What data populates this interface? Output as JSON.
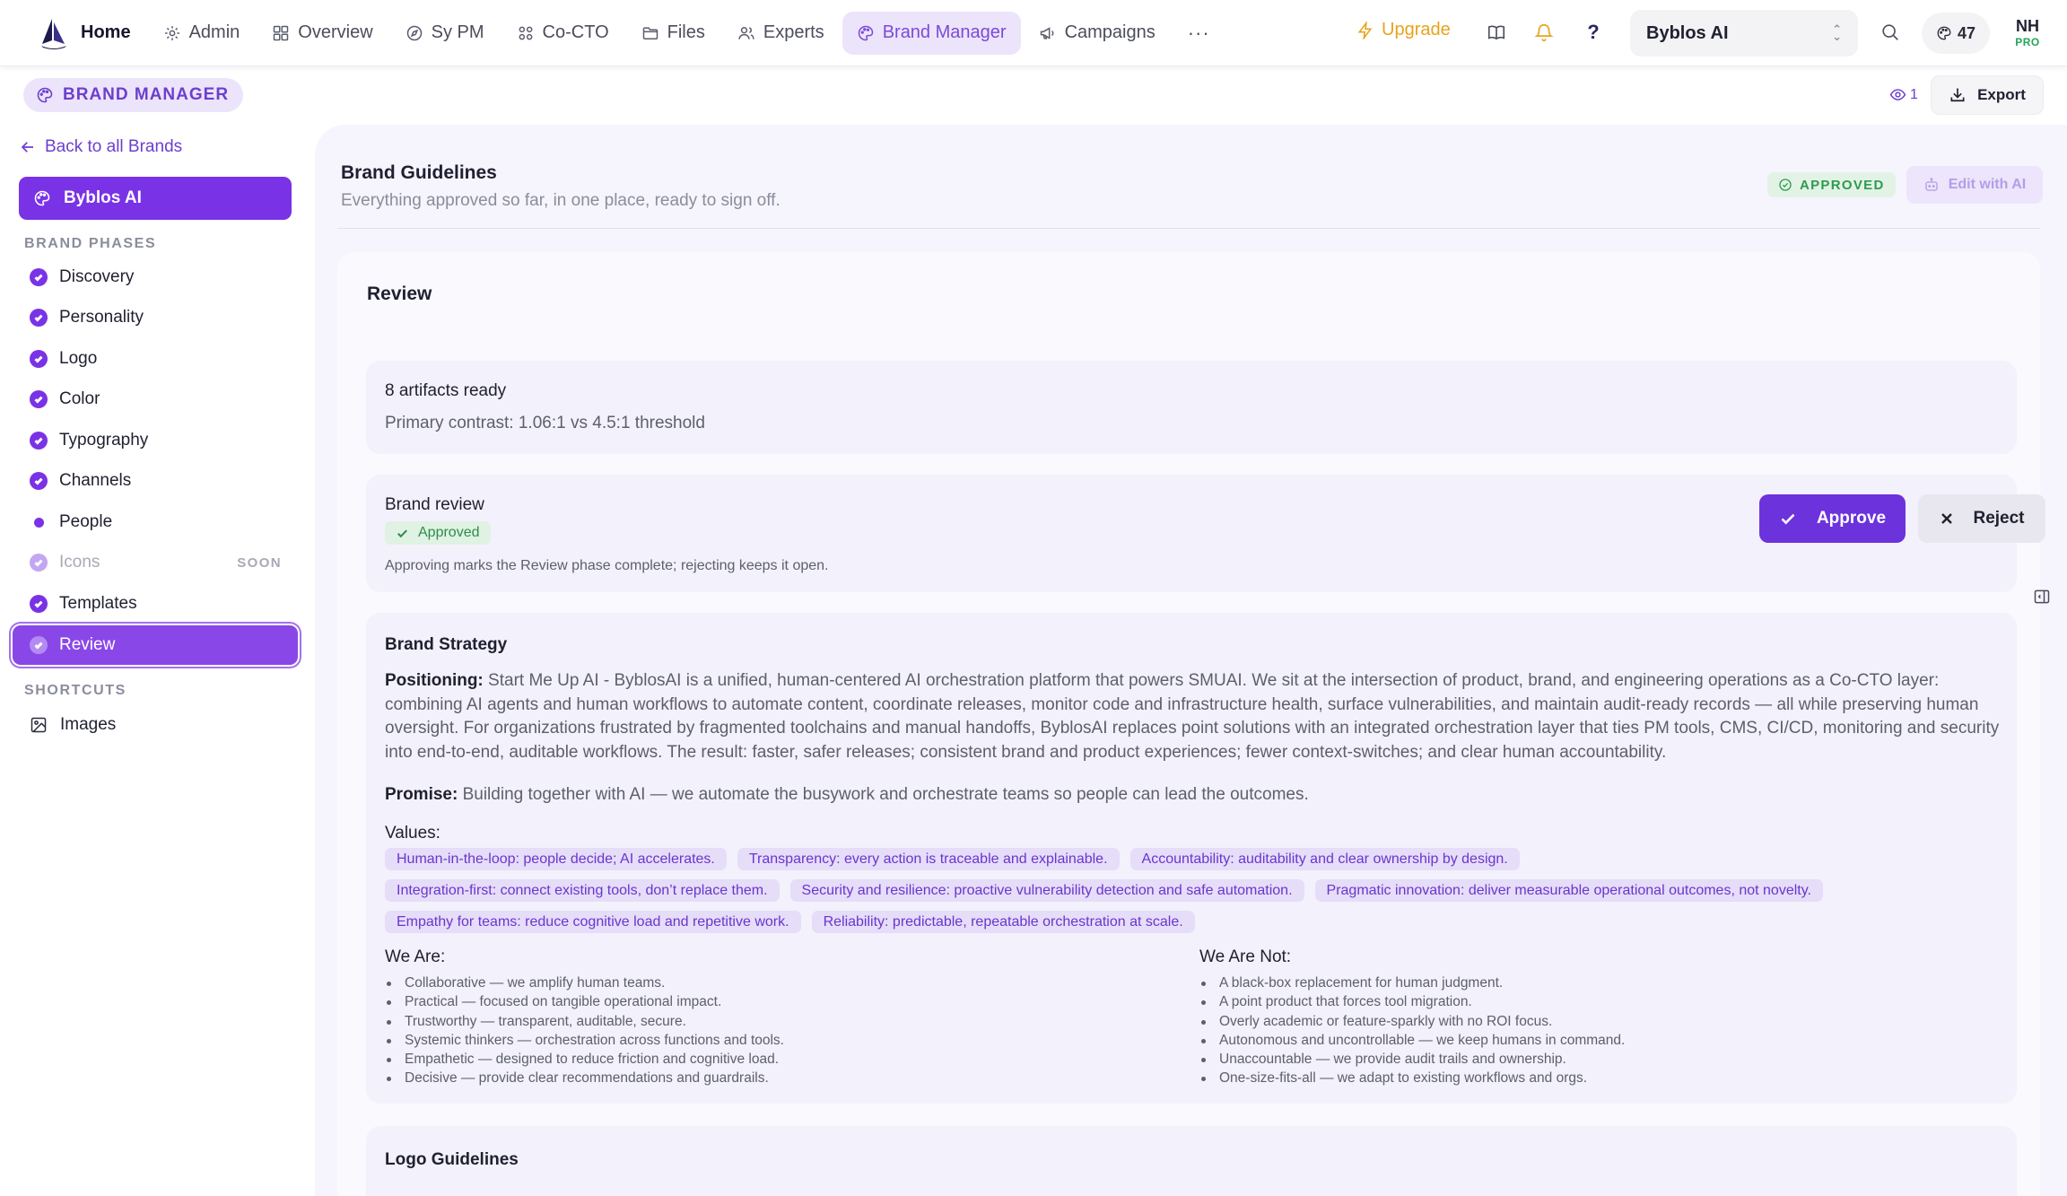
{
  "nav": {
    "home": "Home",
    "items": [
      {
        "label": "Admin",
        "icon": "gear-icon"
      },
      {
        "label": "Overview",
        "icon": "grid-icon"
      },
      {
        "label": "Sy PM",
        "icon": "compass-icon"
      },
      {
        "label": "Co-CTO",
        "icon": "nodes-icon"
      },
      {
        "label": "Files",
        "icon": "folder-icon"
      },
      {
        "label": "Experts",
        "icon": "users-icon"
      },
      {
        "label": "Brand Manager",
        "icon": "palette-icon"
      },
      {
        "label": "Campaigns",
        "icon": "megaphone-icon"
      }
    ],
    "more": "···",
    "upgrade": "Upgrade",
    "help": "?",
    "org": "Byblos AI",
    "credits": "47",
    "avatar_initials": "NH",
    "avatar_plan": "PRO"
  },
  "subheader": {
    "badge": "BRAND MANAGER",
    "views": "1",
    "export": "Export"
  },
  "sidebar": {
    "back": "Back to all Brands",
    "brand": "Byblos AI",
    "phases_title": "BRAND PHASES",
    "phases": [
      {
        "label": "Discovery",
        "state": "done"
      },
      {
        "label": "Personality",
        "state": "done"
      },
      {
        "label": "Logo",
        "state": "done"
      },
      {
        "label": "Color",
        "state": "done"
      },
      {
        "label": "Typography",
        "state": "done"
      },
      {
        "label": "Channels",
        "state": "done"
      },
      {
        "label": "People",
        "state": "in-progress"
      },
      {
        "label": "Icons",
        "state": "disabled",
        "badge": "SOON"
      },
      {
        "label": "Templates",
        "state": "done"
      },
      {
        "label": "Review",
        "state": "current"
      }
    ],
    "shortcuts_title": "SHORTCUTS",
    "shortcuts": [
      {
        "label": "Images",
        "icon": "image-icon"
      }
    ]
  },
  "main": {
    "title": "Brand Guidelines",
    "subtitle": "Everything approved so far, in one place, ready to sign off.",
    "status": "APPROVED",
    "edit_ai": "Edit with AI",
    "review_title": "Review",
    "artifacts": {
      "count_label": "8 artifacts ready",
      "contrast": "Primary contrast: 1.06:1 vs 4.5:1 threshold"
    },
    "brand_review": {
      "title": "Brand review",
      "status": "Approved",
      "note": "Approving marks the Review phase complete; rejecting keeps it open.",
      "approve": "Approve",
      "reject": "Reject"
    },
    "strategy": {
      "title": "Brand Strategy",
      "positioning_label": "Positioning:",
      "positioning": "Start Me Up AI - ByblosAI is a unified, human-centered AI orchestration platform that powers SMUAI. We sit at the intersection of product, brand, and engineering operations as a Co-CTO layer: combining AI agents and human workflows to automate content, coordinate releases, monitor code and infrastructure health, surface vulnerabilities, and maintain audit-ready records — all while preserving human oversight. For organizations frustrated by fragmented toolchains and manual handoffs, ByblosAI replaces point solutions with an integrated orchestration layer that ties PM tools, CMS, CI/CD, monitoring and security into end-to-end, auditable workflows. The result: faster, safer releases; consistent brand and product experiences; fewer context-switches; and clear human accountability.",
      "promise_label": "Promise:",
      "promise": "Building together with AI — we automate the busywork and orchestrate teams so people can lead the outcomes.",
      "values_label": "Values:",
      "values": [
        [
          "Human-in-the-loop: people decide; AI accelerates.",
          "Transparency: every action is traceable and explainable.",
          "Accountability: auditability and clear ownership by design."
        ],
        [
          "Integration-first: connect existing tools, don’t replace them.",
          "Security and resilience: proactive vulnerability detection and safe automation.",
          "Pragmatic innovation: deliver measurable operational outcomes, not novelty."
        ],
        [
          "Empathy for teams: reduce cognitive load and repetitive work.",
          "Reliability: predictable, repeatable orchestration at scale."
        ]
      ],
      "we_are_label": "We Are:",
      "we_are": [
        "Collaborative — we amplify human teams.",
        "Practical — focused on tangible operational impact.",
        "Trustworthy — transparent, auditable, secure.",
        "Systemic thinkers — orchestration across functions and tools.",
        "Empathetic — designed to reduce friction and cognitive load.",
        "Decisive — provide clear recommendations and guardrails."
      ],
      "we_are_not_label": "We Are Not:",
      "we_are_not": [
        "A black-box replacement for human judgment.",
        "A point product that forces tool migration.",
        "Overly academic or feature-sparkly with no ROI focus.",
        "Autonomous and uncontrollable — we keep humans in command.",
        "Unaccountable — we provide audit trails and ownership.",
        "One-size-fits-all — we adapt to existing workflows and orgs."
      ]
    },
    "logo_title": "Logo Guidelines"
  },
  "colors": {
    "accent": "#7a32e6",
    "accent_soft": "#ece4fb",
    "success": "#2f9b4f",
    "warning": "#e6a41c"
  }
}
